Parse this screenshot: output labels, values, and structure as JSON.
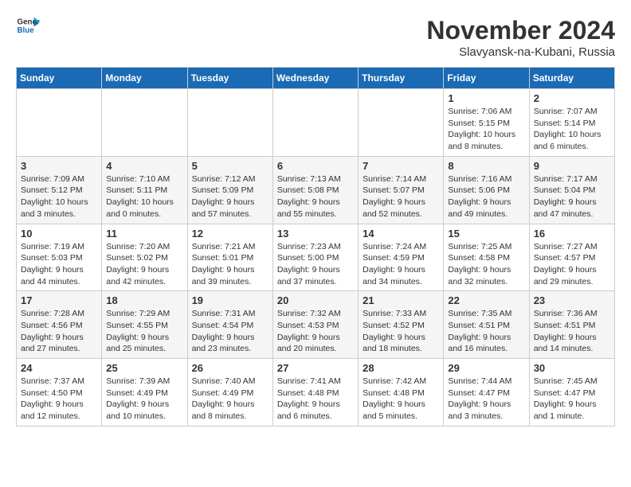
{
  "logo": {
    "line1": "General",
    "line2": "Blue"
  },
  "title": "November 2024",
  "location": "Slavyansk-na-Kubani, Russia",
  "weekdays": [
    "Sunday",
    "Monday",
    "Tuesday",
    "Wednesday",
    "Thursday",
    "Friday",
    "Saturday"
  ],
  "weeks": [
    [
      {
        "day": "",
        "info": ""
      },
      {
        "day": "",
        "info": ""
      },
      {
        "day": "",
        "info": ""
      },
      {
        "day": "",
        "info": ""
      },
      {
        "day": "",
        "info": ""
      },
      {
        "day": "1",
        "info": "Sunrise: 7:06 AM\nSunset: 5:15 PM\nDaylight: 10 hours\nand 8 minutes."
      },
      {
        "day": "2",
        "info": "Sunrise: 7:07 AM\nSunset: 5:14 PM\nDaylight: 10 hours\nand 6 minutes."
      }
    ],
    [
      {
        "day": "3",
        "info": "Sunrise: 7:09 AM\nSunset: 5:12 PM\nDaylight: 10 hours\nand 3 minutes."
      },
      {
        "day": "4",
        "info": "Sunrise: 7:10 AM\nSunset: 5:11 PM\nDaylight: 10 hours\nand 0 minutes."
      },
      {
        "day": "5",
        "info": "Sunrise: 7:12 AM\nSunset: 5:09 PM\nDaylight: 9 hours\nand 57 minutes."
      },
      {
        "day": "6",
        "info": "Sunrise: 7:13 AM\nSunset: 5:08 PM\nDaylight: 9 hours\nand 55 minutes."
      },
      {
        "day": "7",
        "info": "Sunrise: 7:14 AM\nSunset: 5:07 PM\nDaylight: 9 hours\nand 52 minutes."
      },
      {
        "day": "8",
        "info": "Sunrise: 7:16 AM\nSunset: 5:06 PM\nDaylight: 9 hours\nand 49 minutes."
      },
      {
        "day": "9",
        "info": "Sunrise: 7:17 AM\nSunset: 5:04 PM\nDaylight: 9 hours\nand 47 minutes."
      }
    ],
    [
      {
        "day": "10",
        "info": "Sunrise: 7:19 AM\nSunset: 5:03 PM\nDaylight: 9 hours\nand 44 minutes."
      },
      {
        "day": "11",
        "info": "Sunrise: 7:20 AM\nSunset: 5:02 PM\nDaylight: 9 hours\nand 42 minutes."
      },
      {
        "day": "12",
        "info": "Sunrise: 7:21 AM\nSunset: 5:01 PM\nDaylight: 9 hours\nand 39 minutes."
      },
      {
        "day": "13",
        "info": "Sunrise: 7:23 AM\nSunset: 5:00 PM\nDaylight: 9 hours\nand 37 minutes."
      },
      {
        "day": "14",
        "info": "Sunrise: 7:24 AM\nSunset: 4:59 PM\nDaylight: 9 hours\nand 34 minutes."
      },
      {
        "day": "15",
        "info": "Sunrise: 7:25 AM\nSunset: 4:58 PM\nDaylight: 9 hours\nand 32 minutes."
      },
      {
        "day": "16",
        "info": "Sunrise: 7:27 AM\nSunset: 4:57 PM\nDaylight: 9 hours\nand 29 minutes."
      }
    ],
    [
      {
        "day": "17",
        "info": "Sunrise: 7:28 AM\nSunset: 4:56 PM\nDaylight: 9 hours\nand 27 minutes."
      },
      {
        "day": "18",
        "info": "Sunrise: 7:29 AM\nSunset: 4:55 PM\nDaylight: 9 hours\nand 25 minutes."
      },
      {
        "day": "19",
        "info": "Sunrise: 7:31 AM\nSunset: 4:54 PM\nDaylight: 9 hours\nand 23 minutes."
      },
      {
        "day": "20",
        "info": "Sunrise: 7:32 AM\nSunset: 4:53 PM\nDaylight: 9 hours\nand 20 minutes."
      },
      {
        "day": "21",
        "info": "Sunrise: 7:33 AM\nSunset: 4:52 PM\nDaylight: 9 hours\nand 18 minutes."
      },
      {
        "day": "22",
        "info": "Sunrise: 7:35 AM\nSunset: 4:51 PM\nDaylight: 9 hours\nand 16 minutes."
      },
      {
        "day": "23",
        "info": "Sunrise: 7:36 AM\nSunset: 4:51 PM\nDaylight: 9 hours\nand 14 minutes."
      }
    ],
    [
      {
        "day": "24",
        "info": "Sunrise: 7:37 AM\nSunset: 4:50 PM\nDaylight: 9 hours\nand 12 minutes."
      },
      {
        "day": "25",
        "info": "Sunrise: 7:39 AM\nSunset: 4:49 PM\nDaylight: 9 hours\nand 10 minutes."
      },
      {
        "day": "26",
        "info": "Sunrise: 7:40 AM\nSunset: 4:49 PM\nDaylight: 9 hours\nand 8 minutes."
      },
      {
        "day": "27",
        "info": "Sunrise: 7:41 AM\nSunset: 4:48 PM\nDaylight: 9 hours\nand 6 minutes."
      },
      {
        "day": "28",
        "info": "Sunrise: 7:42 AM\nSunset: 4:48 PM\nDaylight: 9 hours\nand 5 minutes."
      },
      {
        "day": "29",
        "info": "Sunrise: 7:44 AM\nSunset: 4:47 PM\nDaylight: 9 hours\nand 3 minutes."
      },
      {
        "day": "30",
        "info": "Sunrise: 7:45 AM\nSunset: 4:47 PM\nDaylight: 9 hours\nand 1 minute."
      }
    ]
  ]
}
